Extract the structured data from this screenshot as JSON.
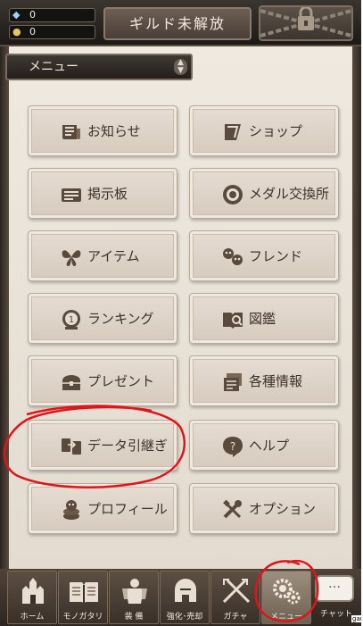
{
  "header": {
    "gems": "0",
    "coins": "0",
    "guild_label": "ギルド未解放"
  },
  "menu": {
    "title": "メニュー"
  },
  "buttons": {
    "news": "お知らせ",
    "shop": "ショップ",
    "board": "掲示板",
    "medal_exchange": "メダル交換所",
    "item": "アイテム",
    "friend": "フレンド",
    "ranking": "ランキング",
    "encyclopedia": "図鑑",
    "present": "プレゼント",
    "info": "各種情報",
    "data_transfer": "データ引継ぎ",
    "help": "ヘルプ",
    "profile": "プロフィール",
    "options": "オプション"
  },
  "tabs": {
    "home": "ホーム",
    "monogatari": "モノガタリ",
    "equip": "装 備",
    "enhance": "強化･売却",
    "gacha": "ガチャ",
    "menu": "メニュー",
    "chat": "チャット",
    "chat_bubble": "…"
  },
  "watermark": "game",
  "colors": {
    "annotation": "#e0141b",
    "button_text": "#3e302a"
  }
}
